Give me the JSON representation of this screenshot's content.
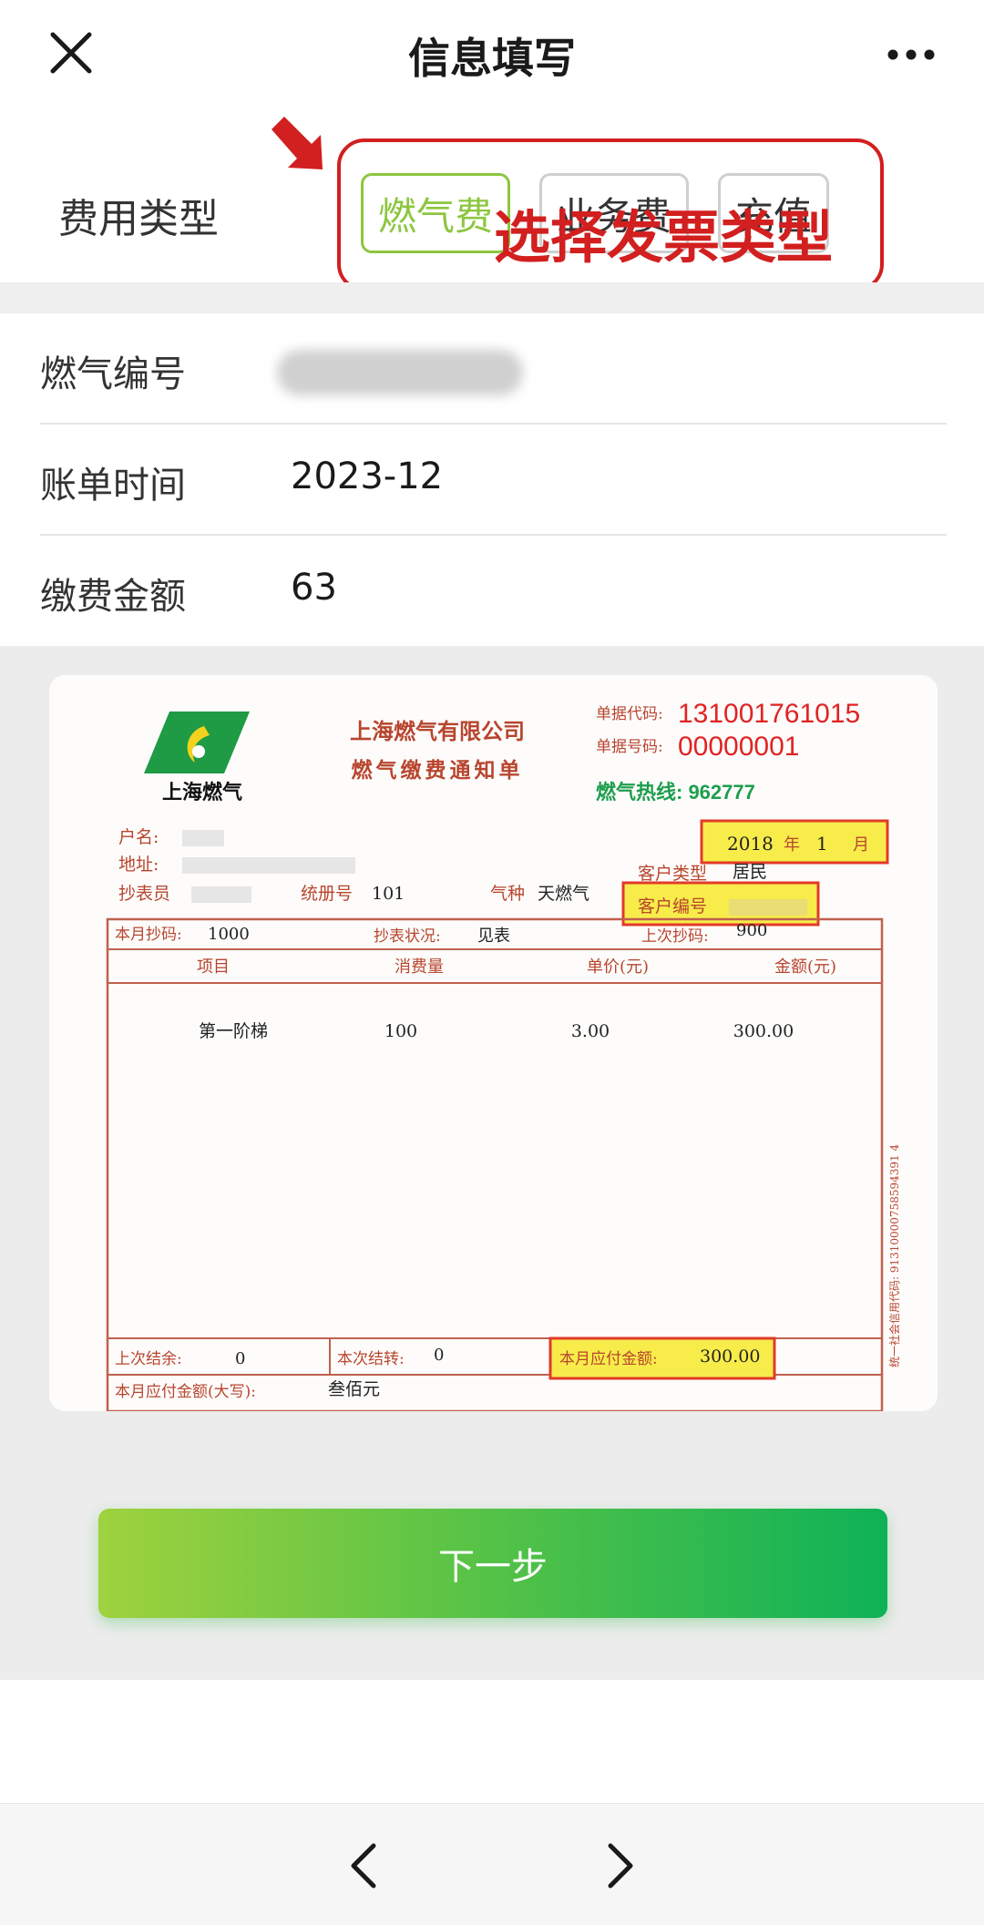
{
  "nav": {
    "title": "信息填写",
    "close_icon": "close-icon",
    "more_icon": "more-dots-icon"
  },
  "fee": {
    "label": "费用类型",
    "options": [
      "燃气费",
      "业务费",
      "充值"
    ],
    "selected": "燃气费",
    "annotation": "选择发票类型"
  },
  "info": {
    "gas_no_label": "燃气编号",
    "bill_time_label": "账单时间",
    "bill_time_value": "2023-12",
    "amount_label": "缴费金额",
    "amount_value": "63"
  },
  "invoice": {
    "logo_text": "上海燃气",
    "company": "上海燃气有限公司",
    "doc_title": "燃气缴费通知单",
    "code_label": "单据代码:",
    "code_value": "131001761015",
    "no_label": "单据号码:",
    "no_value": "00000001",
    "hotline": "燃气热线: 962777",
    "year": "2018",
    "year_unit": "年",
    "month": "1",
    "month_unit": "月",
    "name_label": "户名:",
    "addr_label": "地址:",
    "reader_label": "抄表员",
    "register_label": "统册号",
    "register_value": "101",
    "gas_type_label": "气种",
    "gas_type_value": "天燃气",
    "customer_type_label": "客户类型",
    "customer_type_value": "居民",
    "customer_no_label": "客户编号",
    "this_reading_label": "本月抄码:",
    "this_reading_value": "1000",
    "status_label": "抄表状况:",
    "status_value": "见表",
    "last_reading_label": "上次抄码:",
    "last_reading_value": "900",
    "col_item": "项目",
    "col_usage": "消费量",
    "col_price": "单价(元)",
    "col_amount": "金额(元)",
    "row_item": "第一阶梯",
    "row_usage": "100",
    "row_price": "3.00",
    "row_amount": "300.00",
    "last_balance_label": "上次结余:",
    "last_balance_value": "0",
    "carry_label": "本次结转:",
    "carry_value": "0",
    "payable_label": "本月应付金额:",
    "payable_value": "300.00",
    "payable_words_label": "本月应付金额(大写):",
    "payable_words_value": "叁佰元",
    "side_code": "统一社会信用代码: 91310000758594391 4"
  },
  "next_button": "下一步",
  "bottom": {
    "back_icon": "chevron-left-icon",
    "forward_icon": "chevron-right-icon"
  },
  "colors": {
    "accent_green": "#8dc63f",
    "annotation_red": "#d21f1f",
    "highlight_yellow": "#f7ec4a"
  }
}
